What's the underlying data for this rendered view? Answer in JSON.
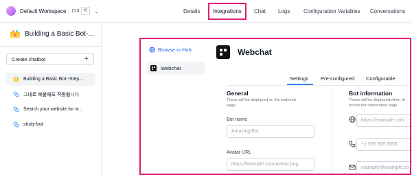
{
  "workspace": {
    "name": "Default Workspace",
    "shortcut_mod": "Ctrl",
    "shortcut_key": "K"
  },
  "nav": {
    "details": "Details",
    "integrations": "Integrations",
    "chat": "Chat",
    "logs": "Logs",
    "config": "Configuration Variables",
    "conversations": "Conversations"
  },
  "sidebar": {
    "bot_title": "Building a Basic Bot-...",
    "create_label": "Create chatbot",
    "items": [
      {
        "label": "Building a Basic Bot--Step..."
      },
      {
        "label": "그대로 복붙해도 작동됩니다"
      },
      {
        "label": "Search your website for w..."
      },
      {
        "label": "study-bot"
      }
    ]
  },
  "integration": {
    "browse_label": "Browse in Hub",
    "list_item": "Webchat",
    "title": "Webchat",
    "tabs": [
      "Settings",
      "Pre-configured",
      "Configurable"
    ],
    "general": {
      "title": "General",
      "desc_line1": "These will be displayed on the webchat",
      "desc_line2": "page.",
      "bot_name_label": "Bot name",
      "bot_name_placeholder": "Amazing Bot",
      "avatar_label": "Avatar URL",
      "avatar_placeholder": "https://example.com/avatar.png"
    },
    "bot_info": {
      "title": "Bot information",
      "desc_line1": "These will be displayed when th",
      "desc_line2": "on the bot information page.",
      "website_placeholder": "https://example.com",
      "phone_placeholder": "+1 555 555 5555",
      "email_placeholder": "example@example.co"
    }
  },
  "colors": {
    "highlight": "#e11d74",
    "link": "#2563eb",
    "tab_active": "#3b82f6"
  }
}
